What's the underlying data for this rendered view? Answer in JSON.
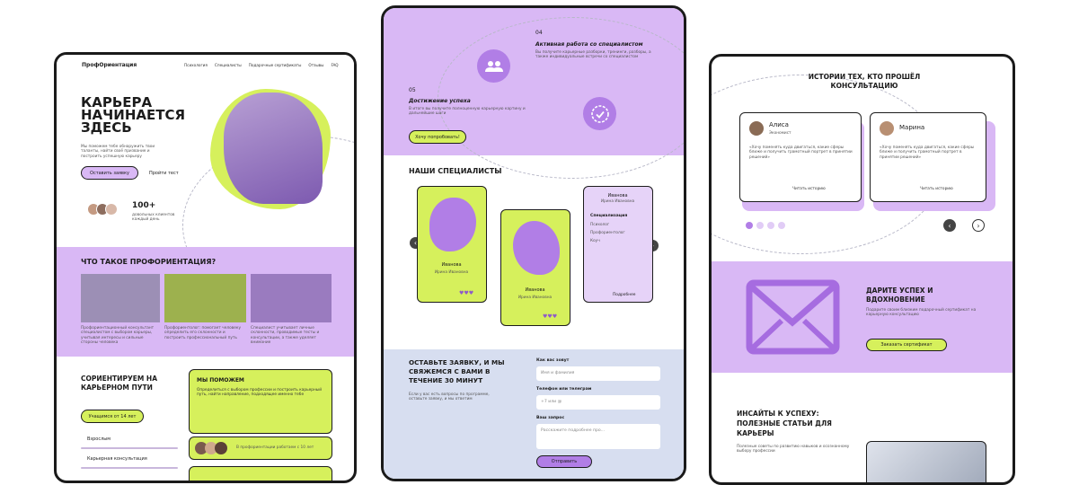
{
  "left": {
    "logo": "ПрофОриентация",
    "nav": [
      "Психология",
      "Специалисты",
      "Подарочные сертификаты",
      "Отзывы",
      "FAQ"
    ],
    "hero_title": "Карьера начинается здесь",
    "hero_sub": "Мы поможем тебе обнаружить твои таланты, найти своё призвание и построить успешную карьеру",
    "btn_primary": "Оставить заявку",
    "btn_secondary": "Пройти тест",
    "stat_value": "100+",
    "stat_label": "довольных клиентов каждый день",
    "section2_title": "Что такое профориентация?",
    "col_texts": [
      "Профориентационный консультант специалистом с выбором карьеры, учитывая интересы и сильные стороны человека",
      "Профориентолог: помогает человеку определить его склонности и построить профессиональный путь",
      "Специалист учитывает личные склонности, проводимые тесты и консультации, а также уделяет внимание"
    ],
    "section3_title": "Сориентируем на карьерном пути",
    "help_title": "Мы поможем",
    "help_text": "Определиться с выбором профессии и построить карьерный путь, найти направление, подходящее именно тебе",
    "age_tag": "Учащимся от 14 лет",
    "list_items": [
      "Взрослым",
      "Карьерная консультация"
    ],
    "mini_card_text": "В профориентации работаем с 10 лет"
  },
  "middle": {
    "step4_num": "04",
    "step4_title": "Активная работа со специалистом",
    "step4_text": "Вы получите карьерные разборки, тренинги, разборы, а также индивидуальные встречи со специалистом",
    "step5_num": "05",
    "step5_title": "Достижение успеха",
    "step5_text": "В итоге вы получите полноценную карьерную картину и дальнейшие шаги",
    "step5_btn": "Хочу попробовать!",
    "specialists_title": "Наши специалисты",
    "spec_name": "Иванова",
    "spec_full": "Ирина Ивановна",
    "spec3_heading": "Специализация",
    "spec3_items": [
      "Психолог",
      "Профориентолог",
      "Коуч"
    ],
    "spec3_more": "Подробнее",
    "form_title": "Оставьте заявку, и мы свяжемся с вами в течение 30 минут",
    "form_sub": "Если у вас есть вопросы по программе, оставьте заявку, и мы ответим",
    "field1_label": "Как вас зовут",
    "field1_placeholder": "Имя и фамилия",
    "field2_label": "Телефон или телеграм",
    "field2_placeholder": "+7 или @",
    "field3_label": "Ваш запрос",
    "field3_placeholder": "Расскажите подробнее про...",
    "submit": "Отправить"
  },
  "right": {
    "reviews_title": "Истории тех, кто прошёл консультацию",
    "rev1_name": "Алиса",
    "rev1_role": "Экономист",
    "rev2_name": "Марина",
    "rev_text": "«Хочу поменять куда двигаться, какие сферы ближе и получить грамотный портрет в принятии решений»",
    "rev_more": "Читать историю",
    "gift_title": "Дарите успех и вдохновение",
    "gift_text": "Подарите своим близким подарочный сертификат на карьерную консультацию",
    "gift_btn": "Заказать сертификат",
    "insights_title": "Инсайты к успеху: полезные статьи для карьеры",
    "insights_text": "Полезные советы по развитию навыков и осознанному выбору профессии",
    "colors": {
      "lime": "#d6f05c",
      "violet": "#d9b8f5",
      "purple": "#b17ee6"
    }
  }
}
